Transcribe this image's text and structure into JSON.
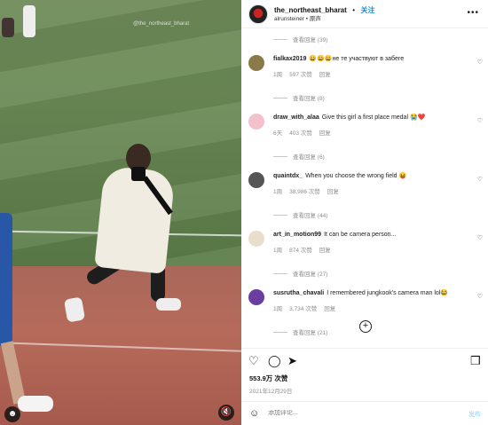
{
  "video": {
    "watermark": "@the_northeast_bharat",
    "user_icon": "user-icon",
    "mute_icon": "mute-icon"
  },
  "header": {
    "username": "the_northeast_bharat",
    "dot": "•",
    "follow_label": "关注",
    "subtitle": "alrunsteiner • 原声",
    "more_icon": "•••"
  },
  "comments": [
    {
      "view_replies": "查看回复 (39)"
    },
    {
      "user": "fialkax2019",
      "text": "😄😄😄не те участвуют в забеге",
      "time": "1周",
      "likes": "597 次赞",
      "reply": "回复",
      "view_replies": "查看回复 (8)",
      "avatar_color": "#8a7a4a"
    },
    {
      "user": "draw_with_alaa",
      "text": "Give this girl a first place medal 😭❤️",
      "time": "6天",
      "likes": "403 次赞",
      "reply": "回复",
      "view_replies": "查看回复 (6)",
      "avatar_color": "#f3c1cc"
    },
    {
      "user": "quaintdx_",
      "text": "When you choose the wrong field 😝",
      "time": "1周",
      "likes": "38,986 次赞",
      "reply": "回复",
      "view_replies": "查看回复 (44)",
      "avatar_color": "#555555"
    },
    {
      "user": "art_in_motion99",
      "text": "It can be camera person...",
      "time": "1周",
      "likes": "874 次赞",
      "reply": "回复",
      "view_replies": "查看回复 (27)",
      "avatar_color": "#e9ddcc"
    },
    {
      "user": "susrutha_chavali",
      "text": "I remembered jungkook's camera man lol😂",
      "time": "1周",
      "likes": "3,734 次赞",
      "reply": "回复",
      "view_replies": "查看回复 (21)",
      "avatar_color": "#6b3fa0"
    }
  ],
  "footer": {
    "likes": "553.9万 次赞",
    "date": "2021年12月29日",
    "add_comment_placeholder": "添加评论...",
    "post_label": "发布"
  },
  "colors": {
    "accent": "#0095f6",
    "muted": "#8e8e8e"
  }
}
